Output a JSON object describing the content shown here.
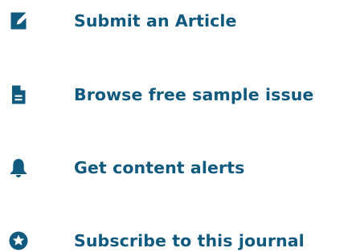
{
  "theme": {
    "accent": "#10597f"
  },
  "links": [
    {
      "label": "Submit an Article",
      "icon": "edit-icon"
    },
    {
      "label": "Browse free sample issue",
      "icon": "document-icon"
    },
    {
      "label": "Get content alerts",
      "icon": "bell-icon"
    },
    {
      "label": "Subscribe to this journal",
      "icon": "star-circle-icon"
    }
  ]
}
